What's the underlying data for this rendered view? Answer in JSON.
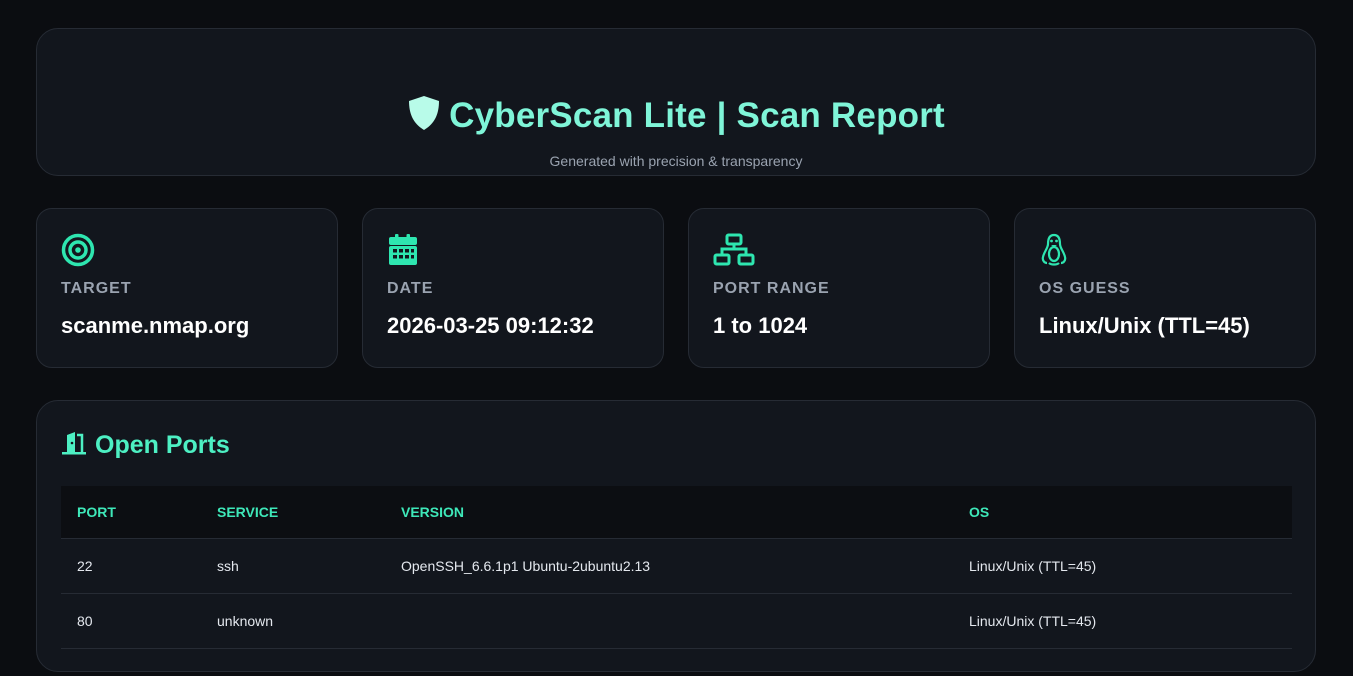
{
  "header": {
    "title": "CyberScan Lite | Scan Report",
    "subtitle": "Generated with precision & transparency",
    "icon": "shield-icon"
  },
  "stats": [
    {
      "icon": "target-icon",
      "label": "TARGET",
      "value": "scanme.nmap.org"
    },
    {
      "icon": "calendar-icon",
      "label": "DATE",
      "value": "2026-03-25 09:12:32"
    },
    {
      "icon": "network-icon",
      "label": "PORT RANGE",
      "value": "1 to 1024"
    },
    {
      "icon": "linux-icon",
      "label": "OS GUESS",
      "value": "Linux/Unix (TTL=45)"
    }
  ],
  "open_ports": {
    "title": "Open Ports",
    "icon": "door-icon",
    "columns": [
      "PORT",
      "SERVICE",
      "VERSION",
      "OS"
    ],
    "rows": [
      {
        "port": "22",
        "service": "ssh",
        "version": "OpenSSH_6.6.1p1 Ubuntu-2ubuntu2.13",
        "os": "Linux/Unix (TTL=45)"
      },
      {
        "port": "80",
        "service": "unknown",
        "version": "",
        "os": "Linux/Unix (TTL=45)"
      }
    ]
  },
  "colors": {
    "accent": "#4df0c3",
    "title": "#7ff5d8",
    "background": "#0b0d11",
    "card": "#12161d"
  }
}
